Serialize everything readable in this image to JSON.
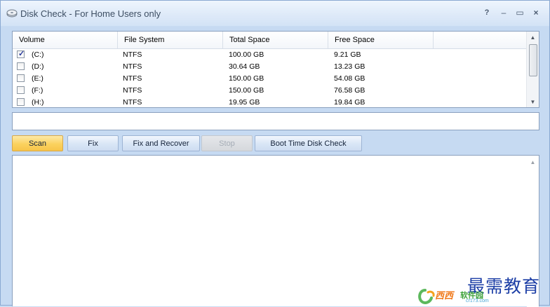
{
  "window": {
    "title": "Disk Check - For Home Users only",
    "controls": {
      "help": "?",
      "minimize": "‒",
      "maximize": "▭",
      "close": "×"
    }
  },
  "volumes": {
    "columns": [
      "Volume",
      "File System",
      "Total Space",
      "Free Space"
    ],
    "rows": [
      {
        "checked": true,
        "volume": "(C:)",
        "fs": "NTFS",
        "total": "100.00 GB",
        "free": "9.21 GB"
      },
      {
        "checked": false,
        "volume": "(D:)",
        "fs": "NTFS",
        "total": "30.64 GB",
        "free": "13.23 GB"
      },
      {
        "checked": false,
        "volume": "(E:)",
        "fs": "NTFS",
        "total": "150.00 GB",
        "free": "54.08 GB"
      },
      {
        "checked": false,
        "volume": "(F:)",
        "fs": "NTFS",
        "total": "150.00 GB",
        "free": "76.58 GB"
      },
      {
        "checked": false,
        "volume": "(H:)",
        "fs": "NTFS",
        "total": "19.95 GB",
        "free": "19.84 GB"
      }
    ]
  },
  "status": {
    "text": ""
  },
  "toolbar": {
    "scan": "Scan",
    "fix": "Fix",
    "fix_recover": "Fix and Recover",
    "stop": "Stop",
    "boot_check": "Boot Time Disk Check"
  },
  "log": {
    "text": ""
  },
  "watermark": {
    "text_cn": "最需教育",
    "logo_text": "西西",
    "logo_text2": "软件园",
    "url": "cr173.com"
  },
  "colors": {
    "accent_active": "#fbd25e",
    "window_bg": "#c6daf2",
    "watermark_blue": "#1d3fa6"
  }
}
